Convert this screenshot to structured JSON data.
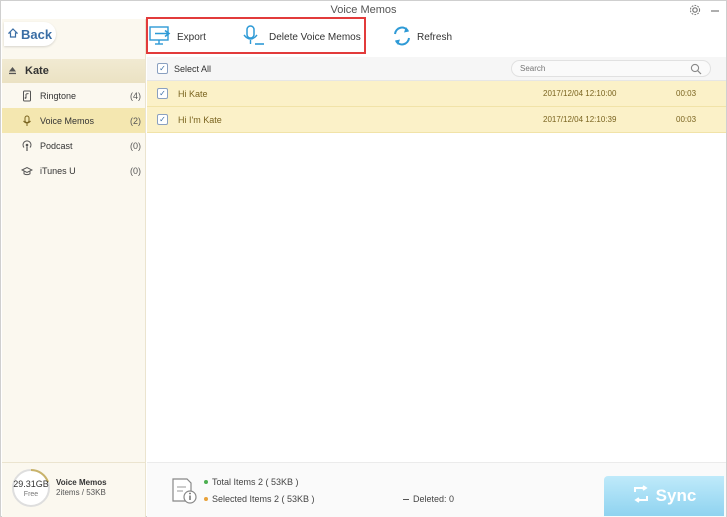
{
  "window": {
    "title": "Voice Memos"
  },
  "sidebar": {
    "back_label": "Back",
    "device_name": "Kate",
    "items": [
      {
        "label": "Ringtone",
        "count": "(4)",
        "icon": "ringtone-icon"
      },
      {
        "label": "Voice Memos",
        "count": "(2)",
        "icon": "microphone-icon",
        "active": true
      },
      {
        "label": "Podcast",
        "count": "(0)",
        "icon": "podcast-icon"
      },
      {
        "label": "iTunes U",
        "count": "(0)",
        "icon": "itunes-u-icon"
      }
    ],
    "storage": {
      "value": "29.31GB",
      "free_label": "Free",
      "title": "Voice Memos",
      "subtitle": "2items / 53KB"
    }
  },
  "toolbar": {
    "export_label": "Export",
    "delete_label": "Delete Voice Memos",
    "refresh_label": "Refresh"
  },
  "list": {
    "select_all_label": "Select All",
    "search_placeholder": "Search",
    "rows": [
      {
        "name": "Hi Kate",
        "date": "2017/12/04 12:10:00",
        "duration": "00:03",
        "checked": true
      },
      {
        "name": "Hi I'm Kate",
        "date": "2017/12/04 12:10:39",
        "duration": "00:03",
        "checked": true
      }
    ]
  },
  "status": {
    "total": "Total Items 2 ( 53KB )",
    "selected": "Selected Items 2 ( 53KB )",
    "deleted": "Deleted: 0",
    "sync_label": "Sync"
  },
  "colors": {
    "accent": "#3a6ea5",
    "highlight_row": "#fbf1c8",
    "sync": "#8fd3f0",
    "annotation": "#e23b3b"
  }
}
